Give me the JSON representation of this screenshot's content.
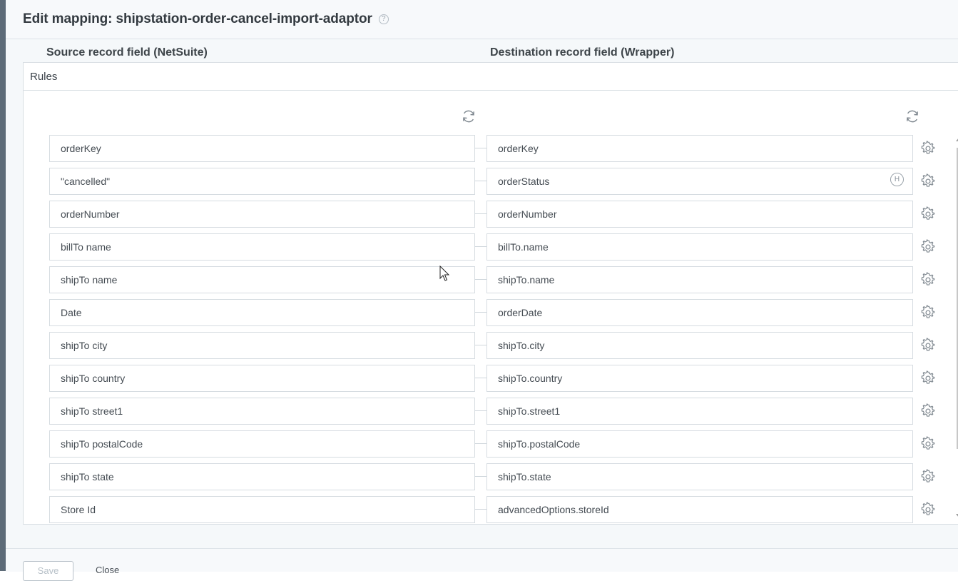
{
  "header": {
    "title": "Edit mapping: shipstation-order-cancel-import-adaptor",
    "help_icon": "question-circle-icon"
  },
  "panel": {
    "title": "Rules"
  },
  "columns": {
    "source_title": "Source record field (NetSuite)",
    "destination_title": "Destination record field (Wrapper)",
    "refresh_icon": "refresh-icon"
  },
  "mappings": [
    {
      "source": "orderKey",
      "destination": "orderKey"
    },
    {
      "source": "\"cancelled\"",
      "destination": "orderStatus",
      "badge": "H"
    },
    {
      "source": "orderNumber",
      "destination": "orderNumber"
    },
    {
      "source": "billTo name",
      "destination": "billTo.name"
    },
    {
      "source": "shipTo name",
      "destination": "shipTo.name"
    },
    {
      "source": "Date",
      "destination": "orderDate"
    },
    {
      "source": "shipTo city",
      "destination": "shipTo.city"
    },
    {
      "source": "shipTo country",
      "destination": "shipTo.country"
    },
    {
      "source": "shipTo street1",
      "destination": "shipTo.street1"
    },
    {
      "source": "shipTo postalCode",
      "destination": "shipTo.postalCode"
    },
    {
      "source": "shipTo state",
      "destination": "shipTo.state"
    },
    {
      "source": "Store Id",
      "destination": "advancedOptions.storeId"
    }
  ],
  "footer": {
    "save_label": "Save",
    "close_label": "Close"
  },
  "colors": {
    "sidebar": "#5d6b78",
    "background": "#f5f8fa",
    "border": "#d6dce1",
    "icon": "#7d868e"
  }
}
